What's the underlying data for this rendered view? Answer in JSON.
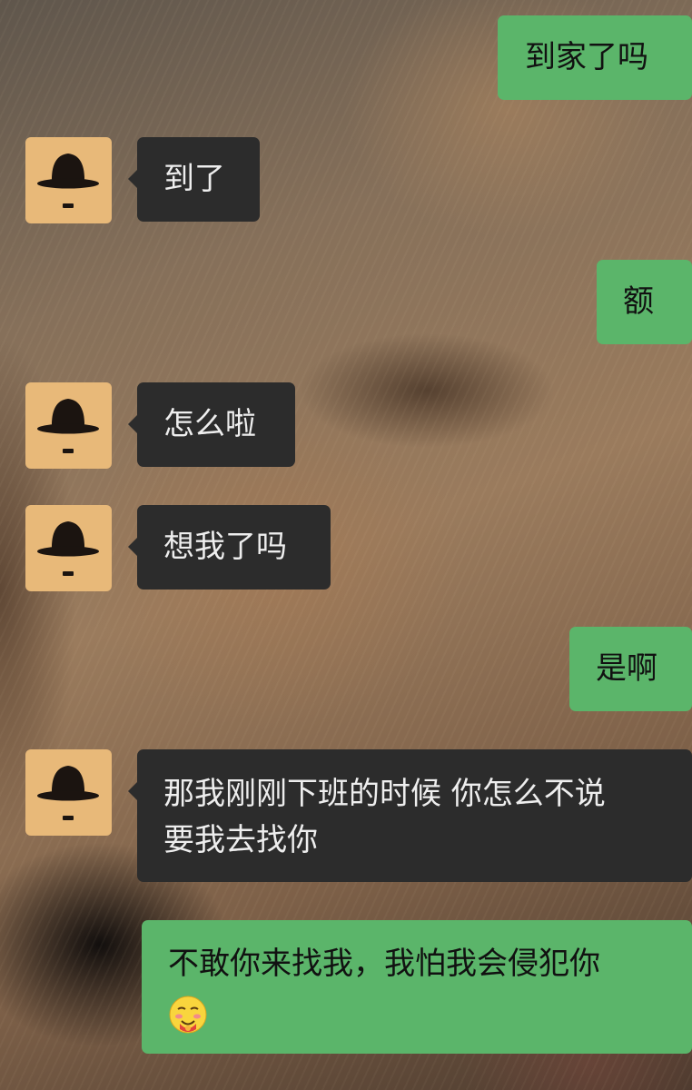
{
  "wallpaper": "golden-retriever-closeup-photo",
  "colors": {
    "sent_bubble": "#5bb56a",
    "received_bubble": "#2c2c2c",
    "avatar_background": "#e8b979"
  },
  "contact": {
    "avatar_icon": "bowler-hat-mustache-icon"
  },
  "messages": [
    {
      "side": "sent",
      "text": "到家了吗"
    },
    {
      "side": "received",
      "text": "到了"
    },
    {
      "side": "sent",
      "text": "额"
    },
    {
      "side": "received",
      "text": "怎么啦"
    },
    {
      "side": "received",
      "text": "想我了吗"
    },
    {
      "side": "sent",
      "text": "是啊"
    },
    {
      "side": "received",
      "lines": [
        "那我刚刚下班的时候 你怎么不说",
        "要我去找你"
      ]
    },
    {
      "side": "sent",
      "text": "不敢你来找我，我怕我会侵犯你",
      "emoji": "blushing-face-icon"
    }
  ]
}
